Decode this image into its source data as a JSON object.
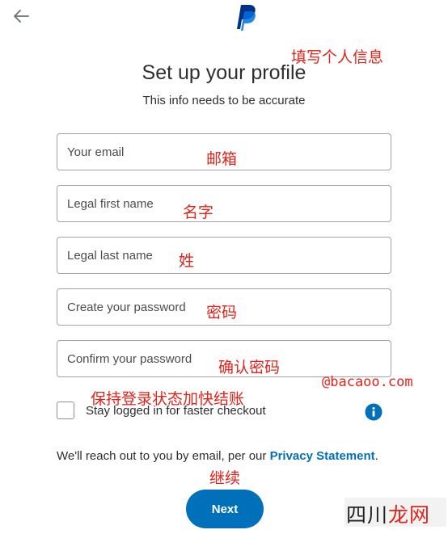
{
  "header": {
    "back_icon": "arrow-left-icon",
    "logo_icon": "paypal-logo-icon",
    "brand_colors": {
      "primary": "#003087",
      "secondary": "#0070e0"
    }
  },
  "annotations": {
    "fill_profile": "填写个人信息",
    "email": "邮箱",
    "first_name": "名字",
    "last_name": "姓",
    "password": "密码",
    "confirm_password": "确认密码",
    "stay_logged_in": "保持登录状态加快结账",
    "next": "继续"
  },
  "main": {
    "title": "Set up your profile",
    "subtitle": "This info needs to be accurate"
  },
  "form": {
    "email_placeholder": "Your email",
    "first_name_placeholder": "Legal first name",
    "last_name_placeholder": "Legal last name",
    "password_placeholder": "Create your password",
    "confirm_password_placeholder": "Confirm your password",
    "stay_logged_in_label": "Stay logged in for faster checkout",
    "info_icon": "info-icon"
  },
  "footer": {
    "reach_text": "We'll reach out to you by email, per our ",
    "privacy_link": "Privacy Statement",
    "period": ".",
    "next_label": "Next"
  },
  "watermarks": {
    "site": "@bacaoo.com",
    "brand_a": "四川",
    "brand_b": "龙网"
  },
  "colors": {
    "accent_blue": "#0070ba",
    "annotation_red": "#e0241b"
  }
}
